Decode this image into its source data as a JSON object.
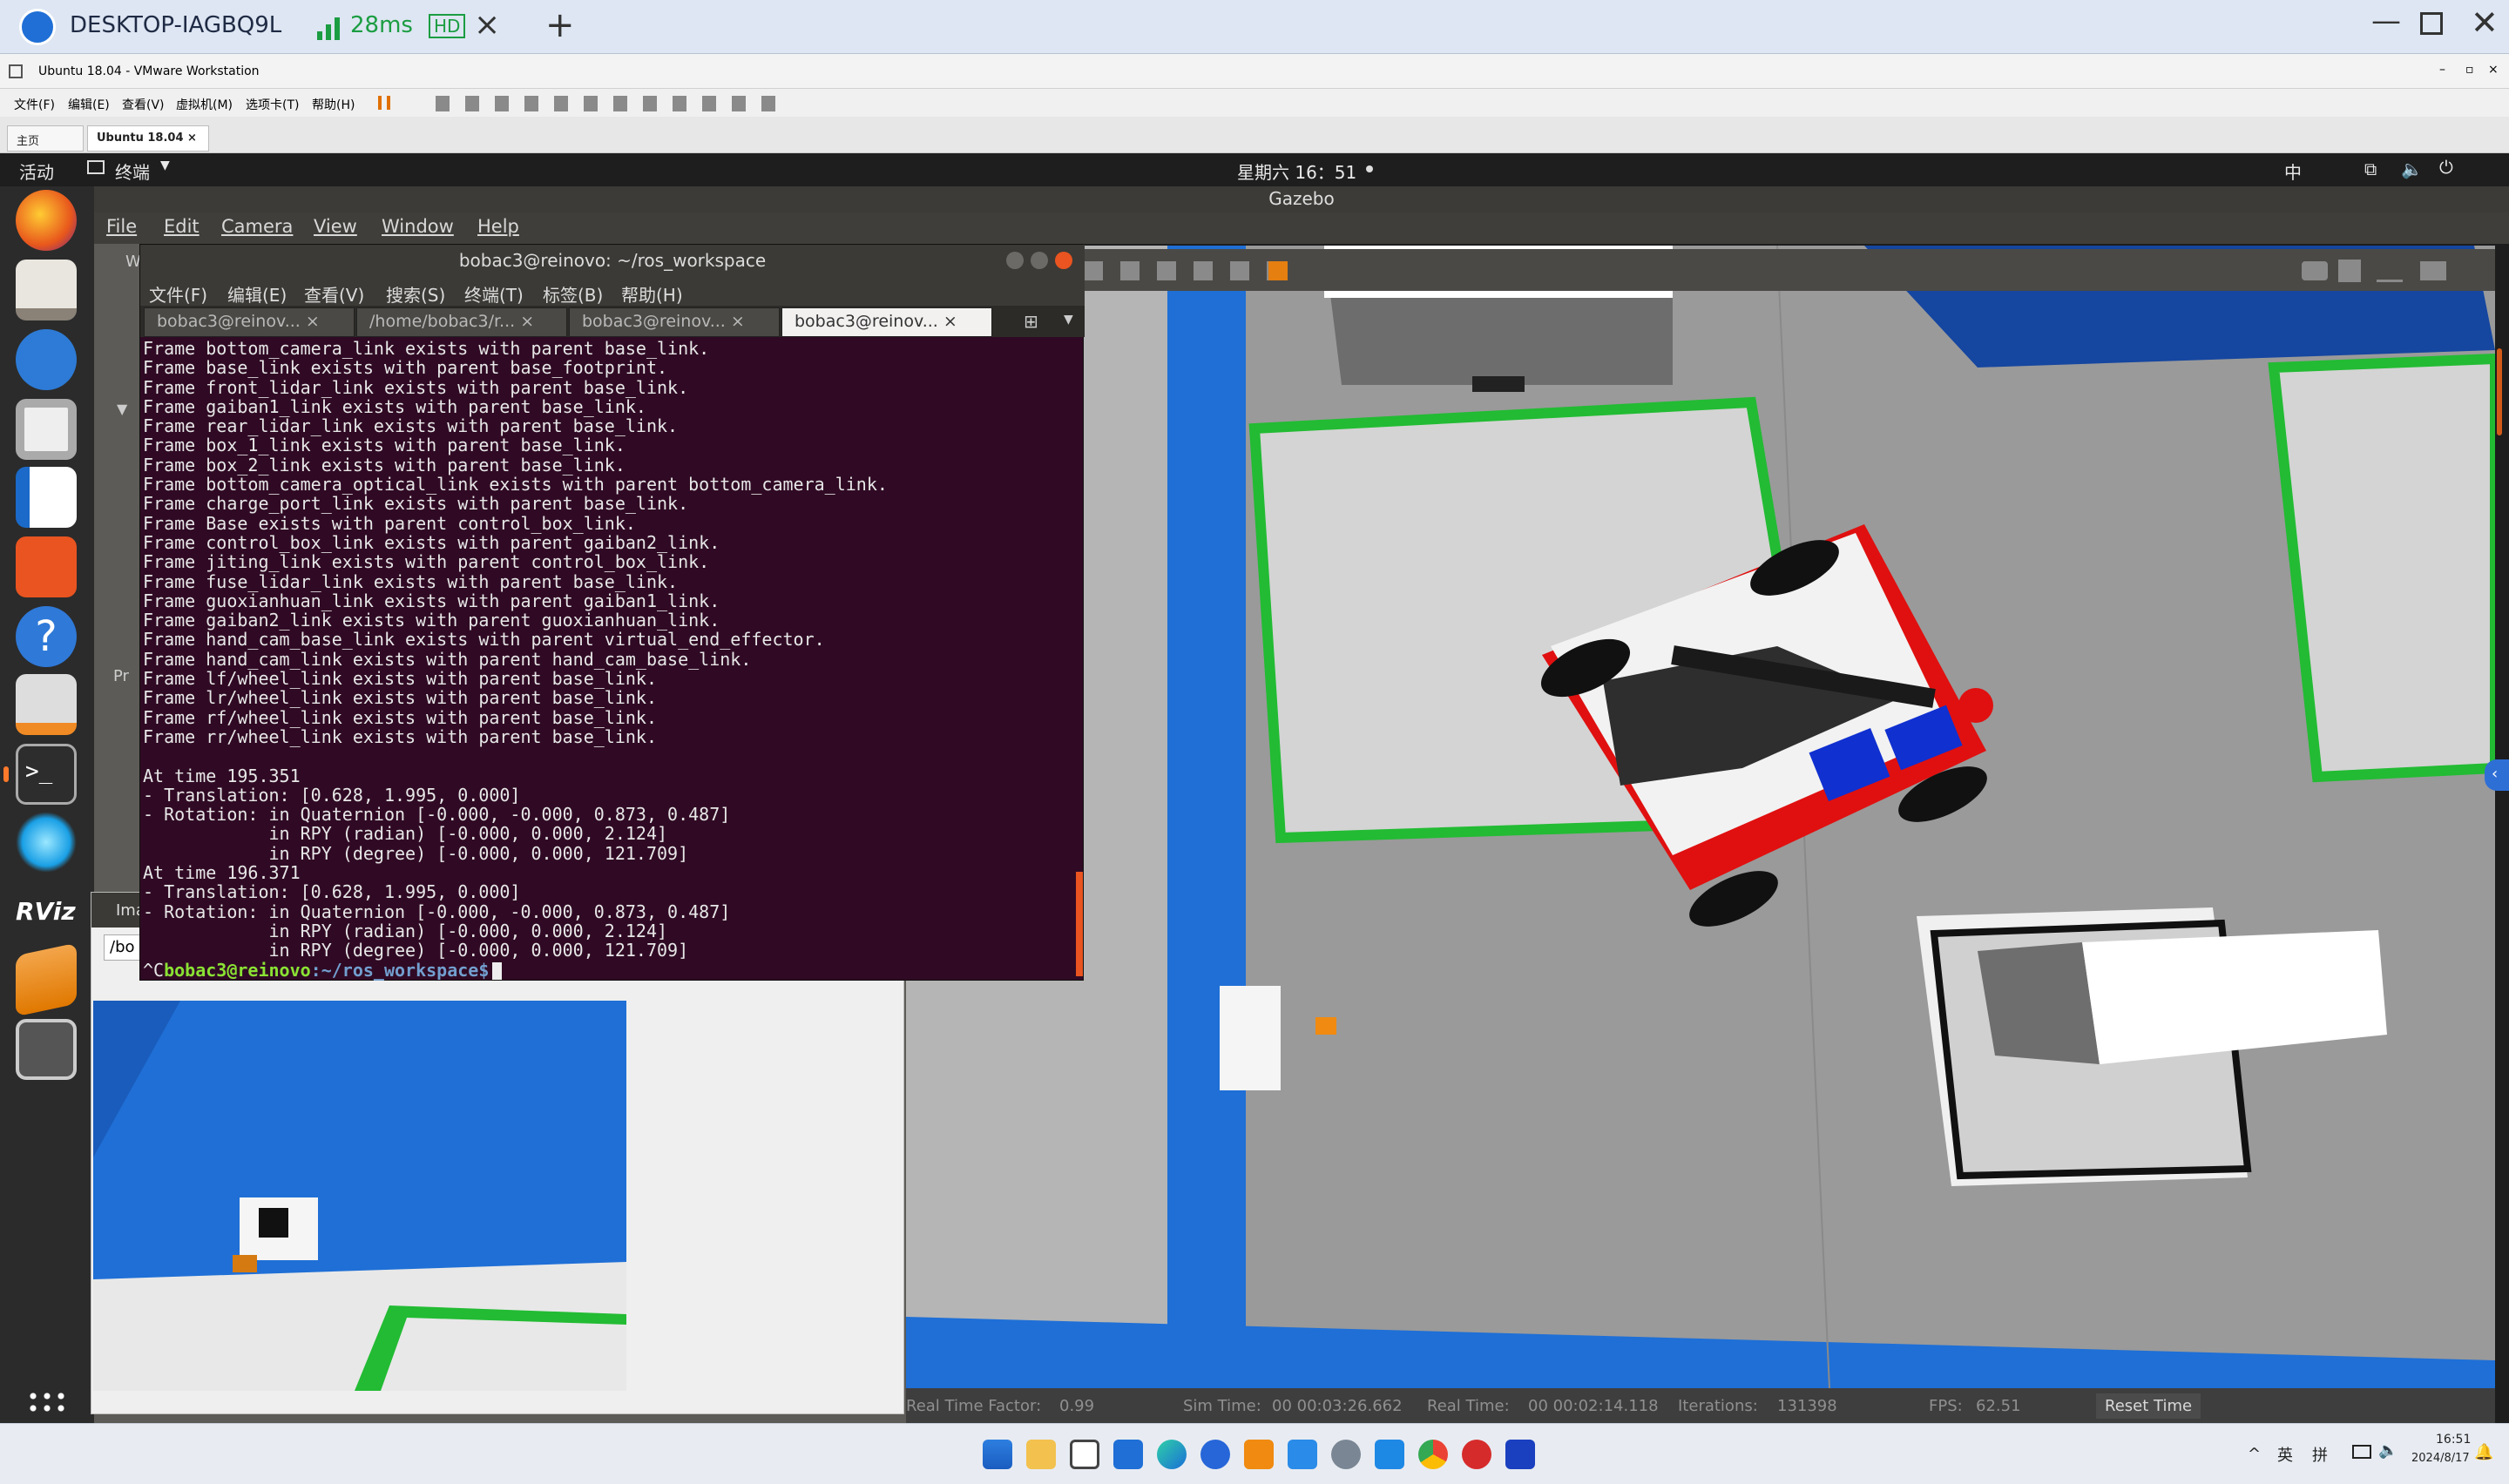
{
  "remote_desktop": {
    "host": "DESKTOP-IAGBQ9L",
    "latency": "28ms",
    "quality": "HD"
  },
  "vmware": {
    "title": "Ubuntu 18.04 - VMware Workstation",
    "menu": [
      "文件(F)",
      "编辑(E)",
      "查看(V)",
      "虚拟机(M)",
      "选项卡(T)",
      "帮助(H)"
    ],
    "tabs": [
      "主页",
      "Ubuntu 18.04"
    ]
  },
  "ubuntu_bar": {
    "activities": "活动",
    "app_menu": "终端",
    "clock": "星期六 16：51",
    "input_method": "中"
  },
  "gazebo": {
    "window_title": "Gazebo",
    "menu": [
      "File",
      "Edit",
      "Camera",
      "View",
      "Window",
      "Help"
    ],
    "status": {
      "real_time_factor_label": "Real Time Factor:",
      "real_time_factor": "0.99",
      "sim_time_label": "Sim Time:",
      "sim_time": "00 00:03:26.662",
      "real_time_label": "Real Time:",
      "real_time": "00 00:02:14.118",
      "iterations_label": "Iterations:",
      "iterations": "131398",
      "fps_label": "FPS:",
      "fps": "62.51",
      "reset_button": "Reset Time"
    },
    "side_labels": {
      "w": "W",
      "pr": "Pr"
    }
  },
  "terminal": {
    "title": "bobac3@reinovo: ~/ros_workspace",
    "menu": [
      "文件(F)",
      "编辑(E)",
      "查看(V)",
      "搜索(S)",
      "终端(T)",
      "标签(B)",
      "帮助(H)"
    ],
    "tabs": [
      "bobac3@reinov...",
      "/home/bobac3/r...",
      "bobac3@reinov...",
      "bobac3@reinov..."
    ],
    "lines": [
      "Frame bottom_camera_link exists with parent base_link.",
      "Frame base_link exists with parent base_footprint.",
      "Frame front_lidar_link exists with parent base_link.",
      "Frame gaiban1_link exists with parent base_link.",
      "Frame rear_lidar_link exists with parent base_link.",
      "Frame box_1_link exists with parent base_link.",
      "Frame box_2_link exists with parent base_link.",
      "Frame bottom_camera_optical_link exists with parent bottom_camera_link.",
      "Frame charge_port_link exists with parent base_link.",
      "Frame Base exists with parent control_box_link.",
      "Frame control_box_link exists with parent gaiban2_link.",
      "Frame jiting_link exists with parent control_box_link.",
      "Frame fuse_lidar_link exists with parent base_link.",
      "Frame guoxianhuan_link exists with parent gaiban1_link.",
      "Frame gaiban2_link exists with parent guoxianhuan_link.",
      "Frame hand_cam_base_link exists with parent virtual_end_effector.",
      "Frame hand_cam_link exists with parent hand_cam_base_link.",
      "Frame lf/wheel_link exists with parent base_link.",
      "Frame lr/wheel_link exists with parent base_link.",
      "Frame rf/wheel_link exists with parent base_link.",
      "Frame rr/wheel_link exists with parent base_link.",
      "",
      "At time 195.351",
      "- Translation: [0.628, 1.995, 0.000]",
      "- Rotation: in Quaternion [-0.000, -0.000, 0.873, 0.487]",
      "            in RPY (radian) [-0.000, 0.000, 2.124]",
      "            in RPY (degree) [-0.000, 0.000, 121.709]",
      "At time 196.371",
      "- Translation: [0.628, 1.995, 0.000]",
      "- Rotation: in Quaternion [-0.000, -0.000, 0.873, 0.487]",
      "            in RPY (radian) [-0.000, 0.000, 2.124]",
      "            in RPY (degree) [-0.000, 0.000, 121.709]"
    ],
    "prompt_prefix": "^C",
    "prompt_user": "bobac3@reinovo",
    "prompt_path": ":~/ros_workspace$"
  },
  "image_view": {
    "title": "Ima",
    "path": "/bo"
  },
  "dock": {
    "rviz_label": "RViz"
  },
  "taskbar": {
    "lang": "英",
    "ime": "拼",
    "time": "16:51",
    "date": "2024/8/17"
  },
  "colors": {
    "terminal_bg": "#300a24",
    "wall_blue": "#1f6fd6",
    "floor_gray": "#9a9a9a",
    "mat_green": "#22bb33"
  }
}
